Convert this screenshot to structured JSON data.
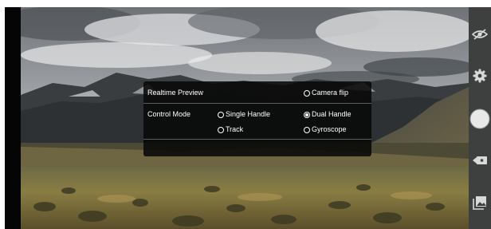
{
  "popup": {
    "realtime_preview_label": "Realtime Preview",
    "camera_flip": {
      "label": "Camera flip",
      "checked": false
    },
    "control_mode_label": "Control Mode",
    "options": {
      "single_handle": {
        "label": "Single Handle",
        "checked": false
      },
      "dual_handle": {
        "label": "Dual Handle",
        "checked": true
      },
      "track": {
        "label": "Track",
        "checked": false
      },
      "gyroscope": {
        "label": "Gyroscope",
        "checked": false
      }
    }
  },
  "right_toolbar": {
    "icons": [
      "eye-off-icon",
      "gear-icon",
      "shutter-icon",
      "video-camera-icon",
      "gallery-icon"
    ]
  },
  "colors": {
    "popup_bg": "#080808",
    "toolbar_bg": "#3e3f3f",
    "text": "#ffffff"
  }
}
